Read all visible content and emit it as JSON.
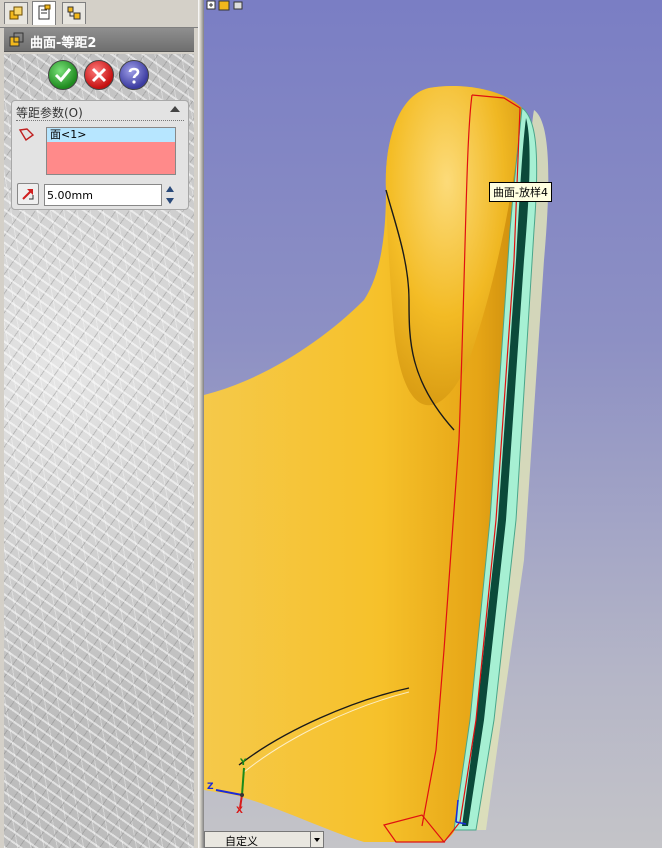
{
  "property_manager": {
    "tabs": [
      "feature-manager",
      "property-manager",
      "configuration-manager"
    ],
    "title": "曲面-等距2",
    "buttons": {
      "ok": "ok",
      "cancel": "cancel",
      "help": "help"
    },
    "offset_group": {
      "header": "等距参数(O)",
      "selected_faces": [
        "面<1>"
      ],
      "distance_value": "5.00mm"
    }
  },
  "viewport": {
    "tooltip": "曲面-放样4",
    "view_orientation": "自定义",
    "triad": {
      "x": "X",
      "y": "Y",
      "z": "Z"
    },
    "colors": {
      "model_fill": "#f2b81c",
      "offset_surface": "#9ff0d2",
      "offset_dark": "#0b4a3a",
      "edge_red": "#e01010"
    }
  }
}
